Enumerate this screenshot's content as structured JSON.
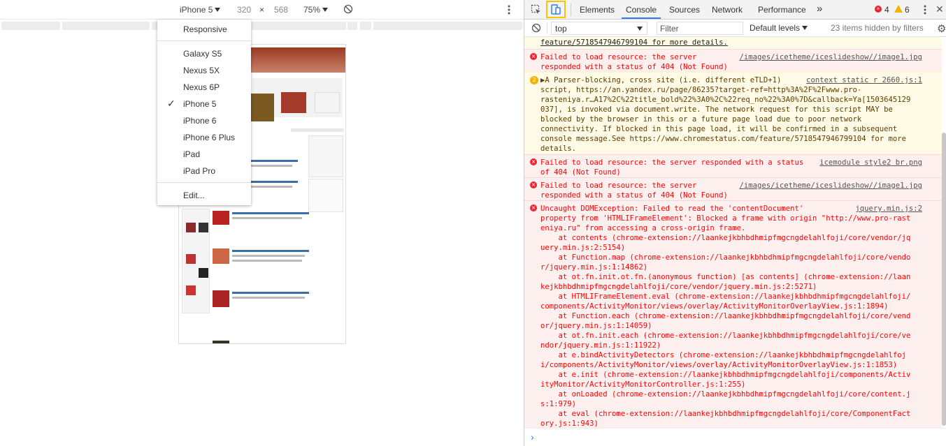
{
  "device_toolbar": {
    "device": "iPhone 5",
    "width": "320",
    "times": "×",
    "height": "568",
    "zoom": "75%"
  },
  "device_menu": {
    "items": [
      "Responsive",
      "Galaxy S5",
      "Nexus 5X",
      "Nexus 6P",
      "iPhone 5",
      "iPhone 6",
      "iPhone 6 Plus",
      "iPad",
      "iPad Pro",
      "Edit..."
    ],
    "checked": "iPhone 5",
    "check": "✓"
  },
  "devtools": {
    "tabs": [
      "Elements",
      "Console",
      "Sources",
      "Network",
      "Performance"
    ],
    "more": "»",
    "error_count": "4",
    "warning_count": "6"
  },
  "console_toolbar": {
    "context": "top",
    "filter_placeholder": "Filter",
    "levels": "Default levels",
    "hidden": "23 items hidden by filters"
  },
  "messages": {
    "m0": {
      "l1": "feature/5718547946799104 for more details."
    },
    "m1": {
      "l1": "Failed to load resource: the server",
      "l2": "responded with a status of 404 (Not Found)",
      "src": "/images/icetheme/iceslideshow//image1.jpg"
    },
    "m2": {
      "badge": "2",
      "src": "context static r 2660.js:1",
      "l1": "▶A Parser-blocking, cross site (i.e. different eTLD+1)",
      "l2": "script, https://an.yandex.ru/page/86235?target-ref=http%3A%2F%2Fwww.pro-",
      "l3": "rasteniya.r…A17%2C%22title_bold%22%3A0%2C%22req_no%22%3A0%7D&callback=Ya[1503645129",
      "l4": "037], is invoked via document.write. The network request for this script MAY be",
      "l5": "blocked by the browser in this or a future page load due to poor network",
      "l6": "connectivity. If blocked in this page load, it will be confirmed in a subsequent",
      "l7": "console message.See https://www.chromestatus.com/feature/5718547946799104 for more",
      "l8": "details."
    },
    "m3": {
      "l1": "Failed to load resource: the server responded with a status",
      "l2": "of 404 (Not Found)",
      "src": "icemodule style2 br.png"
    },
    "m4": {
      "l1": "Failed to load resource: the server",
      "l2": "responded with a status of 404 (Not Found)",
      "src": "/images/icetheme/iceslideshow//image1.jpg"
    },
    "m5": {
      "src": "jquery.min.js:2",
      "l1": "Uncaught DOMException: Failed to read the 'contentDocument'",
      "l2": "property from 'HTMLIFrameElement': Blocked a frame with origin \"http://www.pro-rast",
      "l3": "eniya.ru\" from accessing a cross-origin frame.",
      "l4": "    at contents (chrome-extension://laankejkbhbdhmipfmgcngdelahlfoji/core/vendor/jq",
      "l5": "uery.min.js:2:5154)",
      "l6": "    at Function.map (chrome-extension://laankejkbhbdhmipfmgcngdelahlfoji/core/vendo",
      "l7": "r/jquery.min.js:1:14862)",
      "l8": "    at ot.fn.init.ot.fn.(anonymous function) [as contents] (chrome-extension://laan",
      "l9": "kejkbhbdhmipfmgcngdelahlfoji/core/vendor/jquery.min.js:2:5271)",
      "l10": "    at HTMLIFrameElement.eval (chrome-extension://laankejkbhbdhmipfmgcngdelahlfoji/",
      "l11": "components/ActivityMonitor/views/overlay/ActivityMonitorOverlayView.js:1:1894)",
      "l12": "    at Function.each (chrome-extension://laankejkbhbdhmipfmgcngdelahlfoji/core/vend",
      "l13": "or/jquery.min.js:1:14059)",
      "l14": "    at ot.fn.init.each (chrome-extension://laankejkbhbdhmipfmgcngdelahlfoji/core/ve",
      "l15": "ndor/jquery.min.js:1:11922)",
      "l16": "    at e.bindActivityDetectors (chrome-extension://laankejkbhbdhmipfmgcngdelahlfoj",
      "l17": "i/components/ActivityMonitor/views/overlay/ActivityMonitorOverlayView.js:1:1853)",
      "l18": "    at e.init (chrome-extension://laankejkbhbdhmipfmgcngdelahlfoji/components/Activ",
      "l19": "ityMonitor/ActivityMonitorController.js:1:255)",
      "l20": "    at onLoaded (chrome-extension://laankejkbhbdhmipfmgcngdelahlfoji/core/content.j",
      "l21": "s:1:979)",
      "l22": "    at eval (chrome-extension://laankejkbhbdhmipfmgcngdelahlfoji/core/ComponentFact",
      "l23": "ory.js:1:943)"
    }
  },
  "prompt": "›",
  "colors": {
    "error": "#ff0000",
    "accent": "#367cf1",
    "highlight": "#f7c600"
  }
}
